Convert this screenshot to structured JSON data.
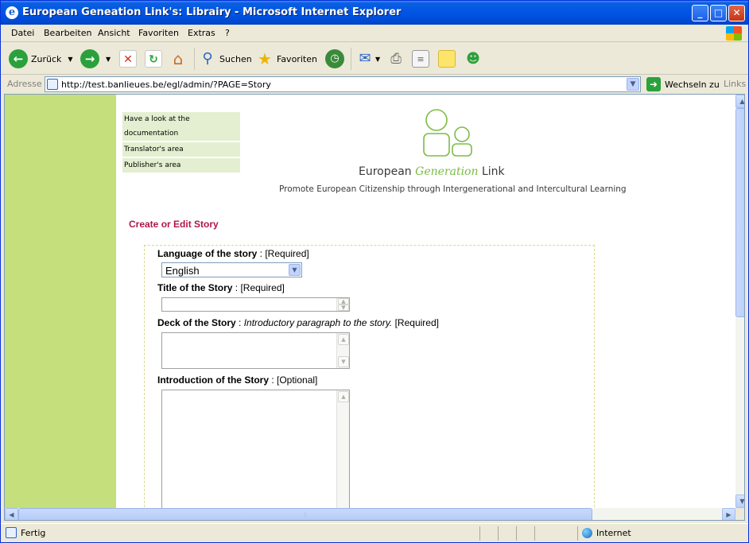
{
  "window": {
    "title": "European Geneation Link's: Librairy - Microsoft Internet Explorer",
    "controls": {
      "minimize": "_",
      "maximize": "□",
      "close": "✕"
    }
  },
  "menu": [
    "Datei",
    "Bearbeiten",
    "Ansicht",
    "Favoriten",
    "Extras",
    "?"
  ],
  "toolbar": {
    "back_label": "Zurück",
    "search_label": "Suchen",
    "favorites_label": "Favoriten"
  },
  "address": {
    "label": "Adresse",
    "url": "http://test.banlieues.be/egl/admin/?PAGE=Story",
    "go_label": "Wechseln zu",
    "links_label": "Links"
  },
  "page": {
    "nav": {
      "documentation": "Have a look at the documentation",
      "translators": "Translator's area",
      "publishers": "Publisher's area"
    },
    "logo": {
      "name_part1": "European ",
      "name_part2": "Generation",
      "name_part3": " Link",
      "tagline": "Promote European Citizenship through Intergenerational and Intercultural Learning"
    },
    "section_title": "Create or Edit Story",
    "form": {
      "language_label": "Language of the story",
      "language_hint": " : [Required]",
      "language_value": "English",
      "title_label": "Title of the Story",
      "title_hint": " : [Required]",
      "title_value": "",
      "deck_label": "Deck of the Story",
      "deck_sep": " : ",
      "deck_hint_italic": "Introductory paragraph to the story.",
      "deck_hint": " [Required]",
      "deck_value": "",
      "intro_label": "Introduction of the Story",
      "intro_hint": " : [Optional]",
      "intro_value": ""
    }
  },
  "status": {
    "text": "Fertig",
    "zone": "Internet"
  },
  "colors": {
    "left_band": "#c4df7c",
    "nav_bg": "#e3efd0",
    "section_title": "#b0174c",
    "logo_green": "#7bbd45"
  }
}
